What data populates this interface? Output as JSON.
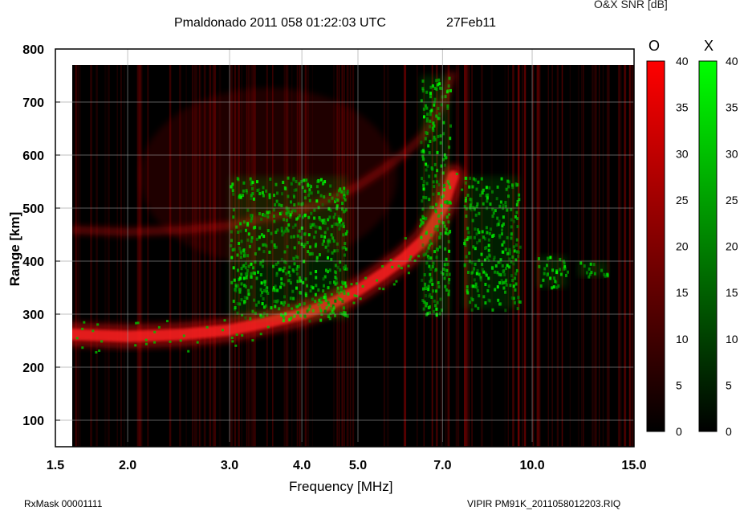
{
  "header": {
    "title": "Pmaldonado 2011 058 01:22:03 UTC",
    "date": "27Feb11",
    "snr_label": "O&X SNR [dB]"
  },
  "footer": {
    "rxmask": "RxMask 00001111",
    "filename": "VIPIR  PM91K_2011058012203.RIQ"
  },
  "chart_data": {
    "type": "heatmap",
    "title": "Pmaldonado 2011 058 01:22:03 UTC",
    "xlabel": "Frequency [MHz]",
    "ylabel": "Range [km]",
    "x_scale": "log",
    "xlim": [
      1.5,
      15.0
    ],
    "ylim": [
      50,
      800
    ],
    "x_ticks": [
      "1.5",
      "2.0",
      "3.0",
      "4.0",
      "5.0",
      "7.0",
      "10.0",
      "15.0"
    ],
    "x_tick_values": [
      1.5,
      2.0,
      3.0,
      4.0,
      5.0,
      7.0,
      10.0,
      15.0
    ],
    "y_ticks": [
      "100",
      "200",
      "300",
      "400",
      "500",
      "600",
      "700",
      "800"
    ],
    "y_tick_values": [
      100,
      200,
      300,
      400,
      500,
      600,
      700,
      800
    ],
    "grid": true,
    "colorbars": [
      {
        "name": "O",
        "color": "#ff0000",
        "range": [
          0,
          40
        ],
        "ticks": [
          "0",
          "5",
          "10",
          "15",
          "20",
          "25",
          "30",
          "35",
          "40"
        ]
      },
      {
        "name": "X",
        "color": "#00ff00",
        "range": [
          0,
          40
        ],
        "ticks": [
          "0",
          "5",
          "10",
          "15",
          "20",
          "25",
          "30",
          "35",
          "40"
        ]
      }
    ],
    "o_trace": {
      "name": "O",
      "points": [
        [
          1.6,
          262
        ],
        [
          2.0,
          258
        ],
        [
          2.5,
          262
        ],
        [
          3.0,
          270
        ],
        [
          3.5,
          285
        ],
        [
          4.0,
          300
        ],
        [
          4.5,
          320
        ],
        [
          5.0,
          345
        ],
        [
          5.5,
          375
        ],
        [
          6.0,
          405
        ],
        [
          6.5,
          440
        ],
        [
          7.0,
          500
        ],
        [
          7.3,
          560
        ]
      ]
    },
    "x_patches": [
      {
        "name": "X",
        "freq": [
          3.0,
          4.8
        ],
        "range": [
          290,
          560
        ]
      },
      {
        "name": "X",
        "freq": [
          6.4,
          7.2
        ],
        "range": [
          300,
          750
        ]
      },
      {
        "name": "X",
        "freq": [
          7.6,
          9.5
        ],
        "range": [
          310,
          560
        ]
      },
      {
        "name": "X",
        "freq": [
          10.2,
          11.5
        ],
        "range": [
          350,
          410
        ]
      },
      {
        "name": "X",
        "freq": [
          12.0,
          13.5
        ],
        "range": [
          370,
          400
        ]
      }
    ]
  },
  "colors": {
    "o_color": "#ff0000",
    "x_color": "#00ff00",
    "background": "#000000"
  }
}
